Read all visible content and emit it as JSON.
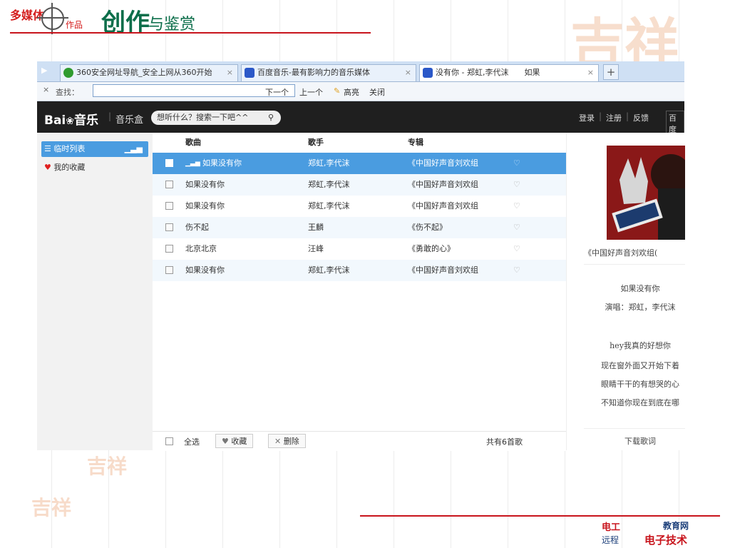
{
  "slide": {
    "title_part1": "多媒体",
    "title_part2": "作品",
    "title_main": "创作",
    "title_tail": "与鉴赏",
    "seal_text": "吉祥",
    "bottom_logo_a": "电工",
    "bottom_logo_b": "教育网",
    "bottom_logo_c": "远程",
    "bottom_logo_d": "电子技术"
  },
  "browser": {
    "tabs": [
      {
        "label": "360安全网址导航_安全上网从360开始",
        "icon": "360-icon",
        "color": "#2f9b2f"
      },
      {
        "label": "百度音乐-最有影响力的音乐媒体",
        "icon": "baidu-music-icon",
        "color": "#2b58c8"
      },
      {
        "label": "没有你 - 郑虹,李代沫　　如果",
        "icon": "baidu-music-icon",
        "color": "#2b58c8"
      }
    ],
    "new_tab_symbol": "+",
    "find": {
      "close_symbol": "×",
      "label": "查找：",
      "value": "",
      "next": "下一个",
      "prev": "上一个",
      "highlight": "高亮",
      "close": "关闭"
    }
  },
  "music": {
    "logo_a": "Bai",
    "logo_b": "音乐",
    "logo_c": "音乐盒",
    "search_placeholder": "想听什么？搜索一下吧^^",
    "user_links": [
      "登录",
      "注册",
      "反馈",
      "百度"
    ],
    "sidebar": [
      {
        "label": "临时列表"
      },
      {
        "label": "我的收藏"
      }
    ],
    "columns": [
      "歌曲",
      "歌手",
      "专辑"
    ],
    "songs": [
      {
        "title": "如果没有你",
        "artist": "郑虹,李代沫",
        "album": "《中国好声音刘欢组"
      },
      {
        "title": "如果没有你",
        "artist": "郑虹,李代沫",
        "album": "《中国好声音刘欢组"
      },
      {
        "title": "如果没有你",
        "artist": "郑虹,李代沫",
        "album": "《中国好声音刘欢组"
      },
      {
        "title": "伤不起",
        "artist": "王麟",
        "album": "《伤不起》"
      },
      {
        "title": "北京北京",
        "artist": "汪峰",
        "album": "《勇敢的心》"
      },
      {
        "title": "如果没有你",
        "artist": "郑虹,李代沫",
        "album": "《中国好声音刘欢组"
      }
    ],
    "footer": {
      "select_all": "全选",
      "favorite": "收藏",
      "delete": "删除",
      "count": "共有6首歌"
    },
    "now_playing": {
      "album": "《中国好声音刘欢组(",
      "title": "如果没有你",
      "singer": "演唱：郑虹，李代沫",
      "lyrics": [
        "hey我真的好想你",
        "现在窗外面又开始下着",
        "眼睛干干的有想哭的心",
        "不知道你现在到底在哪"
      ],
      "download": "下载歌词"
    }
  }
}
